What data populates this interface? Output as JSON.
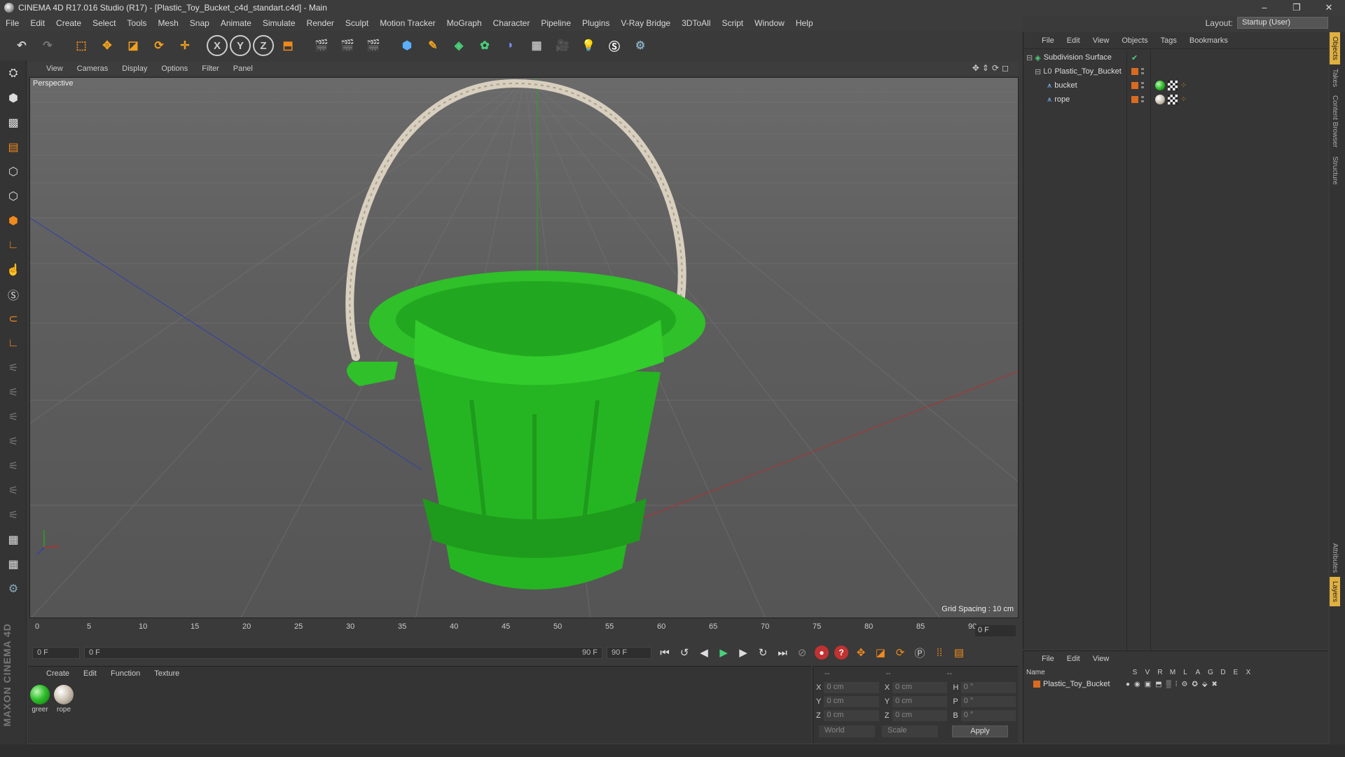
{
  "window": {
    "title": "CINEMA 4D R17.016 Studio (R17) - [Plastic_Toy_Bucket_c4d_standart.c4d] - Main",
    "minimize": "–",
    "restore": "❐",
    "close": "✕"
  },
  "menu": [
    "File",
    "Edit",
    "Create",
    "Select",
    "Tools",
    "Mesh",
    "Snap",
    "Animate",
    "Simulate",
    "Render",
    "Sculpt",
    "Motion Tracker",
    "MoGraph",
    "Character",
    "Pipeline",
    "Plugins",
    "V-Ray Bridge",
    "3DToAll",
    "Script",
    "Window",
    "Help"
  ],
  "layout": {
    "label": "Layout:",
    "value": "Startup (User)"
  },
  "toolbar": {
    "axis_x": "X",
    "axis_y": "Y",
    "axis_z": "Z"
  },
  "viewport": {
    "menu": [
      "View",
      "Cameras",
      "Display",
      "Options",
      "Filter",
      "Panel"
    ],
    "nav_icons": "✥⇕⟳◻",
    "label": "Perspective",
    "grid_spacing": "Grid Spacing : 10 cm"
  },
  "timeline": {
    "ticks": [
      "0",
      "5",
      "10",
      "15",
      "20",
      "25",
      "30",
      "35",
      "40",
      "45",
      "50",
      "55",
      "60",
      "65",
      "70",
      "75",
      "80",
      "85",
      "90"
    ],
    "current_frame": "0 F"
  },
  "playbar": {
    "start": "0 F",
    "range_start": "0 F",
    "range_end": "90 F",
    "end": "90 F"
  },
  "materials": {
    "menu": [
      "Create",
      "Edit",
      "Function",
      "Texture"
    ],
    "items": [
      {
        "label": "greer",
        "color": "#2fc02a"
      },
      {
        "label": "rope",
        "color": "#cfc6b6"
      }
    ]
  },
  "coordinates": {
    "head": [
      "--",
      "--",
      "--"
    ],
    "rows": [
      {
        "a": "X",
        "av": "0 cm",
        "b": "X",
        "bv": "0 cm",
        "c": "H",
        "cv": "0 °"
      },
      {
        "a": "Y",
        "av": "0 cm",
        "b": "Y",
        "bv": "0 cm",
        "c": "P",
        "cv": "0 °"
      },
      {
        "a": "Z",
        "av": "0 cm",
        "b": "Z",
        "bv": "0 cm",
        "c": "B",
        "cv": "0 °"
      }
    ],
    "world": "World",
    "scale": "Scale",
    "apply": "Apply"
  },
  "objects": {
    "menu": [
      "File",
      "Edit",
      "View",
      "Objects",
      "Tags",
      "Bookmarks"
    ],
    "tree": [
      {
        "name": "Subdivision Surface",
        "indent": 0
      },
      {
        "name": "Plastic_Toy_Bucket",
        "indent": 1
      },
      {
        "name": "bucket",
        "indent": 2
      },
      {
        "name": "rope",
        "indent": 2
      }
    ]
  },
  "side_tabs": [
    "Objects",
    "Takes",
    "Content Browser",
    "Structure",
    "Attributes",
    "Layers"
  ],
  "layers": {
    "menu": [
      "File",
      "Edit",
      "View"
    ],
    "columns": [
      "Name",
      "S",
      "V",
      "R",
      "M",
      "L",
      "A",
      "G",
      "D",
      "E",
      "X"
    ],
    "rows": [
      "Plastic_Toy_Bucket"
    ]
  },
  "brand": "MAXON CINEMA 4D",
  "colors": {
    "accent_green": "#2fc02a",
    "orange": "#d96b20"
  }
}
